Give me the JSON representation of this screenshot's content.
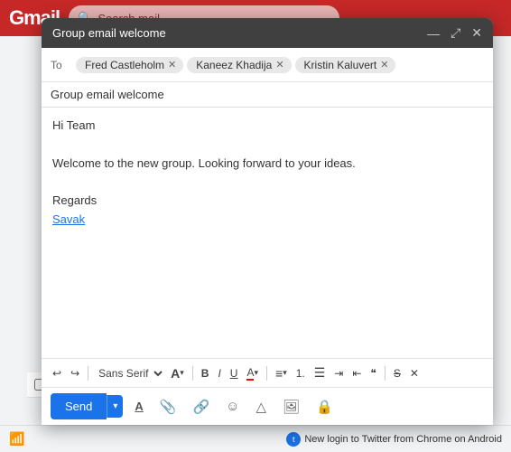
{
  "app": {
    "title": "Gmail",
    "search_placeholder": "Search mail"
  },
  "compose": {
    "header_title": "Group email welcome",
    "to_label": "To",
    "recipients": [
      {
        "name": "Fred Castleholm",
        "id": "fred"
      },
      {
        "name": "Kaneez Khadija",
        "id": "kaneez"
      },
      {
        "name": "Kristin Kaluvert",
        "id": "kristin"
      }
    ],
    "subject": "Group email welcome",
    "body_lines": [
      {
        "text": "Hi Team",
        "type": "text"
      },
      {
        "text": "",
        "type": "spacer"
      },
      {
        "text": "Welcome to the new group. Looking forward to your ideas.",
        "type": "text"
      },
      {
        "text": "",
        "type": "spacer"
      },
      {
        "text": "Regards",
        "type": "text"
      },
      {
        "text": "Savak",
        "type": "link"
      }
    ]
  },
  "toolbar": {
    "undo_label": "↩",
    "redo_label": "↪",
    "font_family": "Sans Serif",
    "font_size_icon": "A",
    "bold_label": "B",
    "italic_label": "I",
    "underline_label": "U",
    "font_color_label": "A",
    "align_label": "≡",
    "ordered_list_label": "1.",
    "unordered_list_label": "•",
    "indent_label": "⇥",
    "outdent_label": "⇤",
    "quote_label": "❝",
    "strike_label": "S",
    "remove_format_label": "✕"
  },
  "actions": {
    "send_label": "Send",
    "send_dropdown_label": "▾",
    "formatting_label": "A",
    "attach_label": "📎",
    "link_label": "🔗",
    "emoji_label": "☺",
    "drive_label": "△",
    "photo_label": "🖼",
    "lock_label": "🔒"
  },
  "status_bar": {
    "notification": "New login to Twitter from Chrome on Android",
    "inbox_sender": "Twitter",
    "checkbox_label": ""
  },
  "header_controls": {
    "minimize": "—",
    "maximize": "⤢",
    "close": "✕"
  }
}
